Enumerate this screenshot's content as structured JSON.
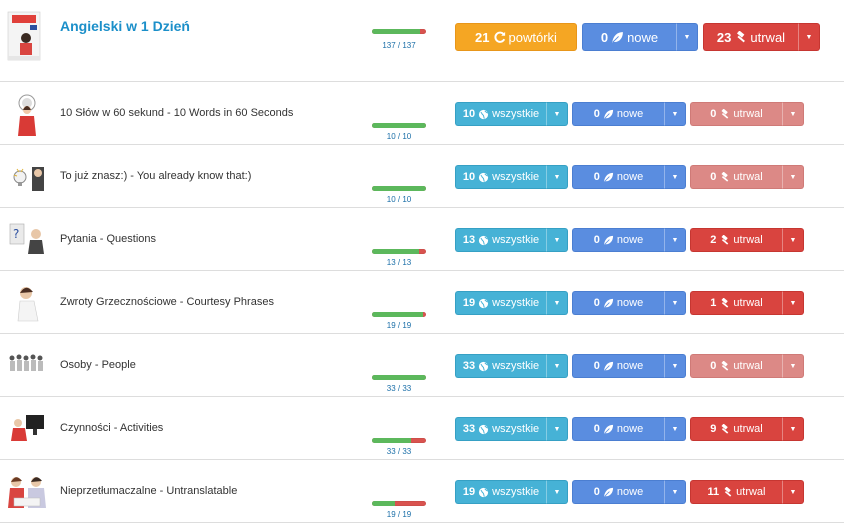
{
  "course": {
    "title": "Angielski w 1 Dzień",
    "progress": {
      "done": 137,
      "total": 137,
      "label": "137 / 137",
      "green_fraction": 0.88
    },
    "review_button": {
      "count": "21",
      "label": "powtórki"
    },
    "new_button": {
      "count": "0",
      "label": "nowe"
    },
    "learned_button": {
      "count": "23",
      "label": "utrwal"
    }
  },
  "lessons": [
    {
      "title": "10 Słów w 60 sekund - 10 Words in 60 Seconds",
      "progress_label": "10 / 10",
      "green_fraction": 1.0,
      "all": {
        "count": "10",
        "label": "wszystkie"
      },
      "new": {
        "count": "0",
        "label": "nowe"
      },
      "learned": {
        "count": "0",
        "label": "utrwal",
        "style": "pink"
      }
    },
    {
      "title": "To już znasz:) - You already know that:)",
      "progress_label": "10 / 10",
      "green_fraction": 1.0,
      "all": {
        "count": "10",
        "label": "wszystkie"
      },
      "new": {
        "count": "0",
        "label": "nowe"
      },
      "learned": {
        "count": "0",
        "label": "utrwal",
        "style": "pink"
      }
    },
    {
      "title": "Pytania - Questions",
      "progress_label": "13 / 13",
      "green_fraction": 0.87,
      "all": {
        "count": "13",
        "label": "wszystkie"
      },
      "new": {
        "count": "0",
        "label": "nowe"
      },
      "learned": {
        "count": "2",
        "label": "utrwal",
        "style": "red"
      }
    },
    {
      "title": "Zwroty Grzecznościowe - Courtesy Phrases",
      "progress_label": "19 / 19",
      "green_fraction": 0.95,
      "all": {
        "count": "19",
        "label": "wszystkie"
      },
      "new": {
        "count": "0",
        "label": "nowe"
      },
      "learned": {
        "count": "1",
        "label": "utrwal",
        "style": "red"
      }
    },
    {
      "title": "Osoby - People",
      "progress_label": "33 / 33",
      "green_fraction": 1.0,
      "all": {
        "count": "33",
        "label": "wszystkie"
      },
      "new": {
        "count": "0",
        "label": "nowe"
      },
      "learned": {
        "count": "0",
        "label": "utrwal",
        "style": "pink"
      }
    },
    {
      "title": "Czynności - Activities",
      "progress_label": "33 / 33",
      "green_fraction": 0.72,
      "all": {
        "count": "33",
        "label": "wszystkie"
      },
      "new": {
        "count": "0",
        "label": "nowe"
      },
      "learned": {
        "count": "9",
        "label": "utrwal",
        "style": "red"
      }
    },
    {
      "title": "Nieprzetłumaczalne - Untranslatable",
      "progress_label": "19 / 19",
      "green_fraction": 0.42,
      "all": {
        "count": "19",
        "label": "wszystkie"
      },
      "new": {
        "count": "0",
        "label": "nowe"
      },
      "learned": {
        "count": "11",
        "label": "utrwal",
        "style": "red"
      }
    }
  ],
  "colors": {
    "title_blue": "#1b8fc9",
    "progress_green": "#5cb85c",
    "progress_red": "#d9534f",
    "btn_orange": "#f5a623",
    "btn_blue": "#5a8de0",
    "btn_cyan": "#46b2d6",
    "btn_red": "#d9443f",
    "btn_pink": "#dc8986"
  },
  "icons": {
    "review": "refresh-icon",
    "new": "leaf-icon",
    "learned": "hammer-icon",
    "all": "globe-icon",
    "dropdown": "caret-down-icon"
  }
}
